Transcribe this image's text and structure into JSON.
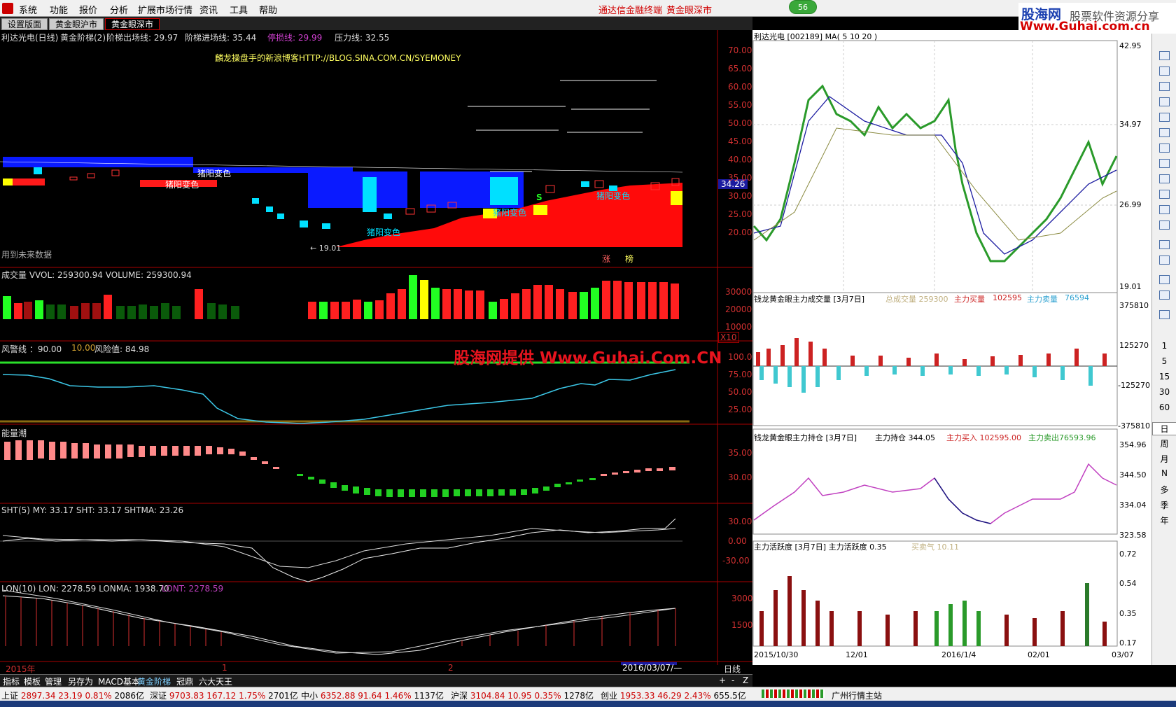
{
  "menu": {
    "items": [
      "系统",
      "功能",
      "报价",
      "分析",
      "扩展市场行情",
      "资讯",
      "工具",
      "帮助"
    ],
    "center_title1": "通达信金融终端",
    "center_title2": "黄金眼深市",
    "badge": "56"
  },
  "brand": {
    "name": "股海网",
    "slogan": "股票软件资源分享",
    "url": "Www.Guhai.com.cn"
  },
  "tabs": [
    "设置版面",
    "黄金眼沪市",
    "黄金眼深市"
  ],
  "main": {
    "title": {
      "stock": "利达光电(日线)",
      "indicator": "黄金阶梯(2)",
      "exit_label": "阶梯出场线: 29.97",
      "entry_label": "阶梯进场线: 35.44",
      "stop_label": "停损线: 29.99",
      "pressure_label": "压力线: 32.55"
    },
    "blog": "麟龙操盘手的新浪博客HTTP://BLOG.SINA.COM.CN/SYEMONEY",
    "future": "用到未来数据",
    "low_marker": "← 19.01",
    "price_tag": "34.26",
    "annotations": [
      "猪阳变色",
      "猪阳变色",
      "猪阳变色",
      "猪阳变色",
      "猪阳变色"
    ],
    "s_mark": "S",
    "zhang": "涨",
    "bang": "榜",
    "price_axis": [
      "70.00",
      "65.00",
      "60.00",
      "55.00",
      "50.00",
      "45.00",
      "40.00",
      "35.00",
      "30.00",
      "25.00",
      "20.00"
    ],
    "vol": {
      "title": "成交量 VVOL: 259300.94 VOLUME: 259300.94",
      "axis": [
        "30000",
        "20000",
        "10000"
      ],
      "unit": "X10"
    },
    "risk": {
      "title_a": "风警线 ：90.00",
      "title_b": "10.00",
      "title_c": "风险值: 84.98",
      "axis": [
        "100.0",
        "75.00",
        "50.00",
        "25.00"
      ]
    },
    "energy": {
      "title": "能量潮",
      "axis": [
        "35.00",
        "30.00"
      ]
    },
    "sht": {
      "title": "SHT(5) MY: 33.17 SHT: 33.17 SHTMA: 23.26",
      "axis": [
        "30.00",
        "0.00",
        "-30.00"
      ]
    },
    "lon": {
      "title_a": "LON(10) LON: 2278.59 LONMA: 1938.70",
      "title_b": "LONT: 2278.59",
      "axis": [
        "3000",
        "1500"
      ]
    },
    "xaxis": {
      "y2015": "2015年",
      "m1": "1",
      "m2": "2",
      "cursor": "2016/03/07/—",
      "period": "日线"
    }
  },
  "watermark": "股海网提供 Www.Guhai.Com.CN",
  "right": {
    "price": {
      "title": "利达光电 [002189] MA( 5 10 20 )",
      "ma_a": "5",
      "ma_b": "10",
      "ma_c": "20",
      "axis": [
        "42.95",
        "34.97",
        "26.99",
        "19.01"
      ]
    },
    "vol": {
      "title": "钱龙黄金眼主力成交量 [3月7日]",
      "total": "总成交量 259300",
      "buy_label": "主力买量",
      "buy": "102595",
      "sell_label": "主力卖量",
      "sell": "76594",
      "axis": [
        "375810",
        "125270",
        "-125270",
        "-375810"
      ]
    },
    "hold": {
      "title": "钱龙黄金眼主力持仓 [3月7日]",
      "hold": "主力持仓 344.05",
      "buy": "主力买入 102595.00",
      "sell": "主力卖出76593.96",
      "axis": [
        "354.96",
        "344.50",
        "334.04",
        "323.58"
      ]
    },
    "act": {
      "title": "主力活跃度 [3月7日] 主力活跃度 0.35",
      "sell_gas": "买卖气 10.11",
      "axis": [
        "0.72",
        "0.54",
        "0.35",
        "0.17"
      ]
    },
    "dates": [
      "2015/10/30",
      "12/01",
      "2016/1/4",
      "02/01",
      "03/07"
    ]
  },
  "toolbar": {
    "periods": [
      "1",
      "5",
      "15",
      "30",
      "60",
      "日",
      "周",
      "月",
      "N",
      "多",
      "季",
      "年"
    ]
  },
  "bottom": {
    "tabs": [
      "指标",
      "模板",
      "管理",
      "另存为",
      "MACD基本",
      "黄金阶梯",
      "冠鼎",
      "六大天王"
    ],
    "controls": [
      "+",
      "-",
      "Z"
    ]
  },
  "status": {
    "items": [
      {
        "name": "上证",
        "v": "2897.34",
        "c": "23.19",
        "p": "0.81%",
        "a": "2086亿"
      },
      {
        "name": "深证",
        "v": "9703.83",
        "c": "167.12",
        "p": "1.75%",
        "a": "2701亿"
      },
      {
        "name": "中小",
        "v": "6352.88",
        "c": "91.64",
        "p": "1.46%",
        "a": "1137亿"
      },
      {
        "name": "沪深",
        "v": "3104.84",
        "c": "10.95",
        "p": "0.35%",
        "a": "1278亿"
      },
      {
        "name": "创业",
        "v": "1953.33",
        "c": "46.29",
        "p": "2.43%",
        "a": "655.5亿"
      }
    ],
    "host": "广州行情主站"
  }
}
